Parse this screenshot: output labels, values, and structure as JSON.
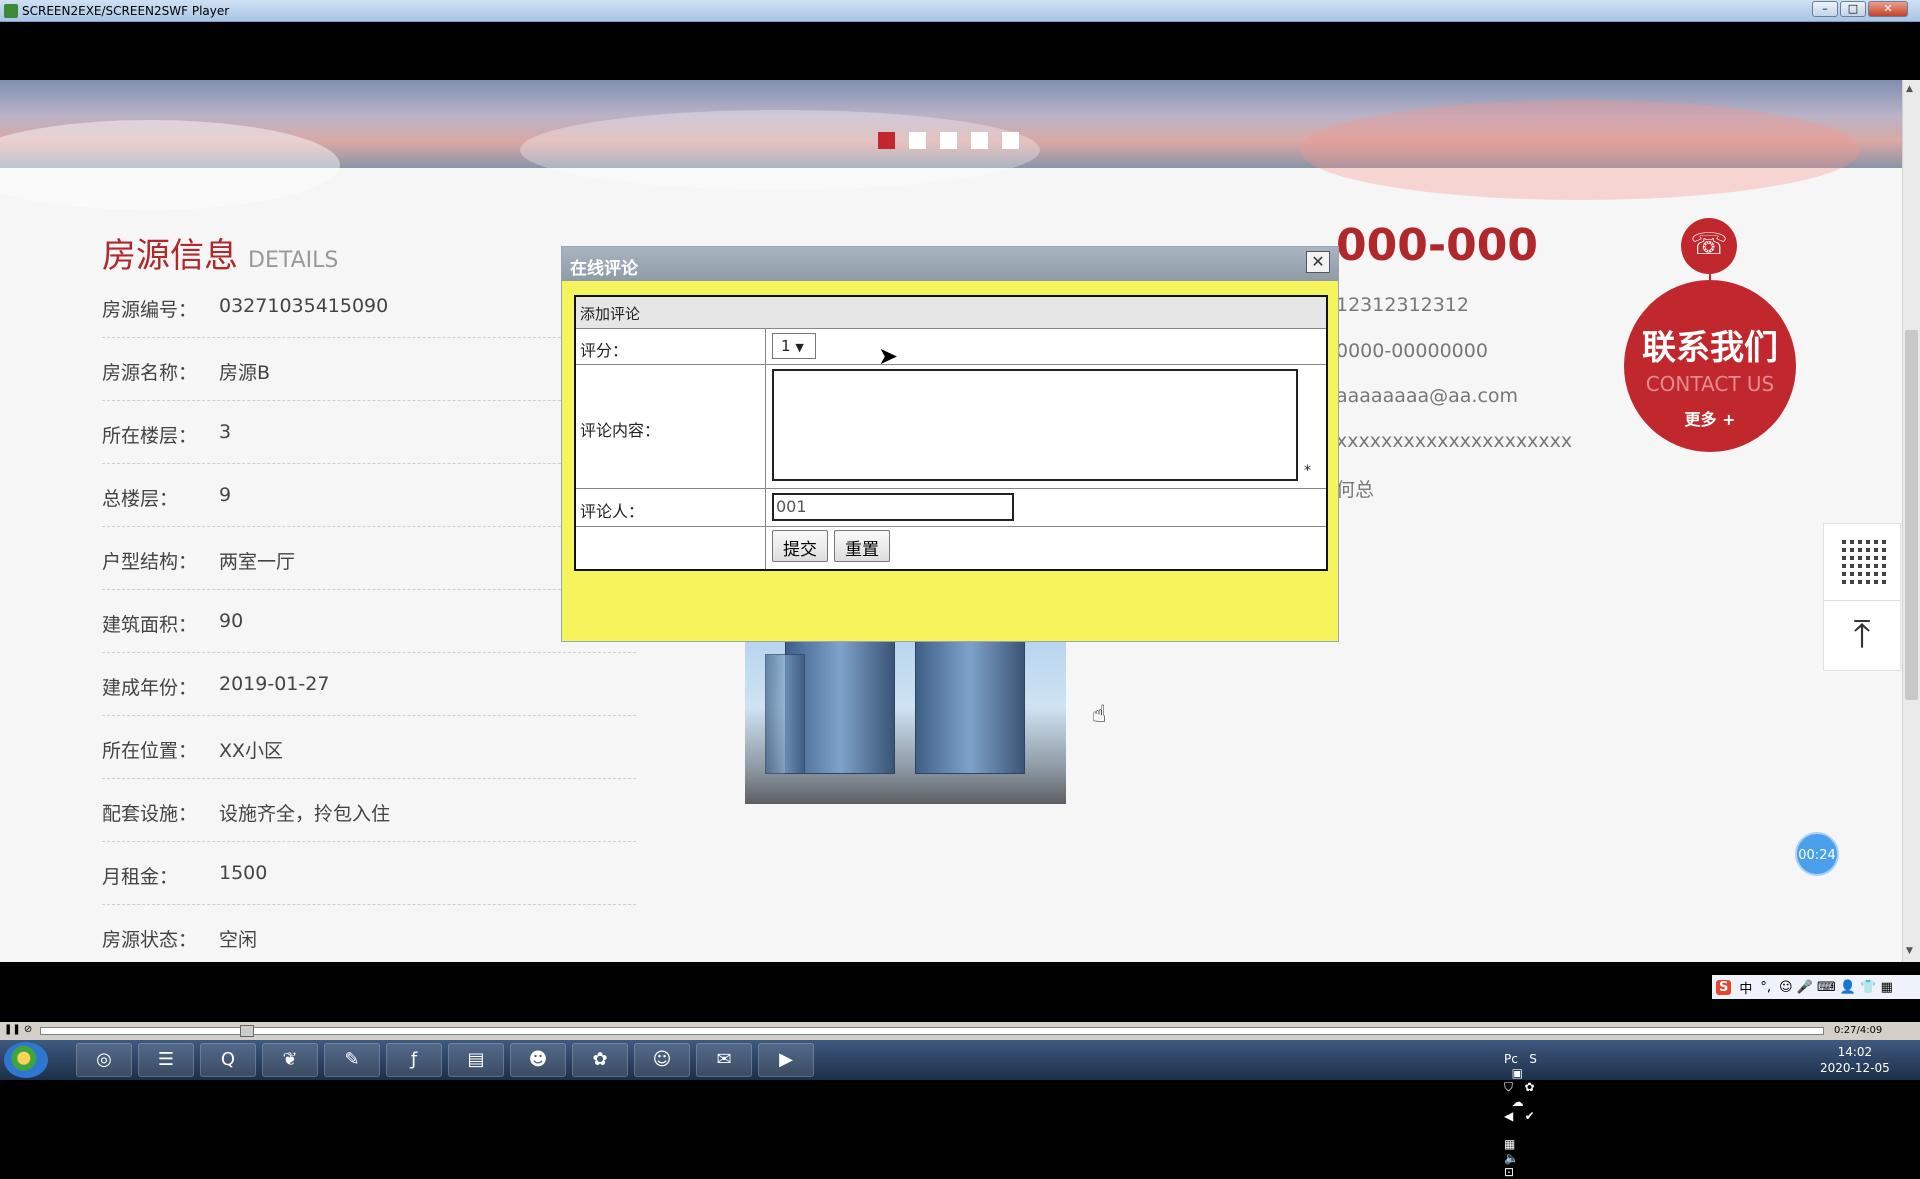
{
  "window": {
    "title": "SCREEN2EXE/SCREEN2SWF Player",
    "min": "–",
    "max": "□",
    "close": "✕"
  },
  "banner": {
    "slides": 5,
    "active_slide": 1
  },
  "details": {
    "title": "房源信息",
    "title_en": "DETAILS",
    "rows": [
      {
        "label": "房源编号：",
        "value": "03271035415090"
      },
      {
        "label": "房源名称：",
        "value": "房源B"
      },
      {
        "label": "所在楼层：",
        "value": "3"
      },
      {
        "label": "总楼层：",
        "value": "9"
      },
      {
        "label": "户型结构：",
        "value": "两室一厅"
      },
      {
        "label": "建筑面积：",
        "value": "90"
      },
      {
        "label": "建成年份：",
        "value": "2019-01-27"
      },
      {
        "label": "所在位置：",
        "value": "XX小区"
      },
      {
        "label": "配套设施：",
        "value": "设施齐全，拎包入住"
      },
      {
        "label": "月租金：",
        "value": "1500"
      },
      {
        "label": "房源状态：",
        "value": "空闲"
      }
    ]
  },
  "contact_info": {
    "phone": "000-000",
    "mobile": "12312312312",
    "tel": "0000-00000000",
    "email": "aaaaaaaa@aa.com",
    "address": "xxxxxxxxxxxxxxxxxxxxx",
    "person": "何总"
  },
  "contact_badge": {
    "zh": "联系我们",
    "en": "CONTACT US",
    "more": "更多 +",
    "phone_icon": "phone-icon"
  },
  "side_tools": {
    "qr_icon": "qr-code-icon",
    "top_icon": "back-to-top-icon",
    "top_glyph": "⤒"
  },
  "timer": "00:24",
  "dialog": {
    "title": "在线评论",
    "close": "✕",
    "section": "添加评论",
    "rating_label": "评分：",
    "rating_value": "1",
    "content_label": "评论内容：",
    "required_mark": "*",
    "commenter_label": "评论人：",
    "commenter_value": "001",
    "submit": "提交",
    "reset": "重置"
  },
  "ime": {
    "logo": "S",
    "mode": "中",
    "punct": "°,",
    "icons": "☺ 🎤 ⌨ 👤 👕 ▦"
  },
  "player": {
    "controls": "❚❚ ⊘",
    "time": "0:27/4:09"
  },
  "taskbar": {
    "apps": [
      {
        "name": "chrome",
        "glyph": "◎"
      },
      {
        "name": "eclipse",
        "glyph": "☰"
      },
      {
        "name": "browser",
        "glyph": "Q"
      },
      {
        "name": "leaf",
        "glyph": "❦"
      },
      {
        "name": "notepad",
        "glyph": "✎"
      },
      {
        "name": "flash",
        "glyph": "ƒ"
      },
      {
        "name": "explorer",
        "glyph": "▤"
      },
      {
        "name": "qq",
        "glyph": "☻"
      },
      {
        "name": "network",
        "glyph": "✿"
      },
      {
        "name": "avatar",
        "glyph": "☺"
      },
      {
        "name": "wechat",
        "glyph": "✉"
      },
      {
        "name": "player",
        "glyph": "▶"
      }
    ],
    "clock_time": "14:02",
    "clock_date": "2020-12-05"
  },
  "colors": {
    "accent": "#c0282d",
    "dialog_bg": "#f5f45c"
  }
}
